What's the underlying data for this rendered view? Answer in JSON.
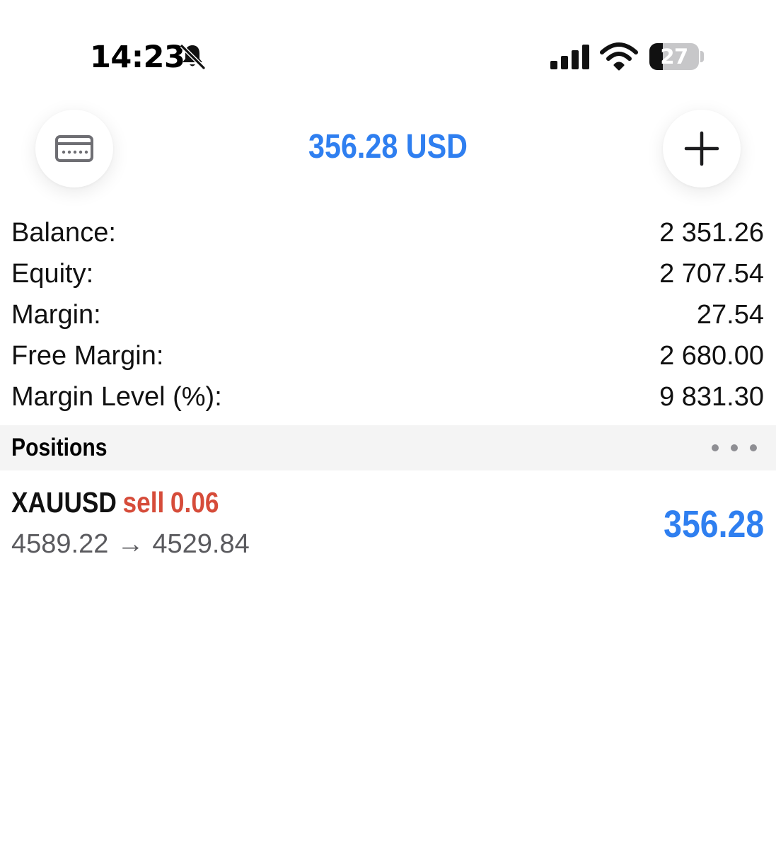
{
  "status_bar": {
    "time": "14:23",
    "battery_level": "27",
    "icons": [
      "bell-slash-icon",
      "signal-icon",
      "wifi-icon",
      "battery-icon"
    ]
  },
  "header": {
    "total": "356.28 USD",
    "left_icon": "card-icon",
    "right_icon": "plus-icon",
    "accent_color": "#2f7ff0"
  },
  "summary": {
    "rows": [
      {
        "label": "Balance:",
        "value": "2 351.26"
      },
      {
        "label": "Equity:",
        "value": "2 707.54"
      },
      {
        "label": "Margin:",
        "value": "27.54"
      },
      {
        "label": "Free Margin:",
        "value": "2 680.00"
      },
      {
        "label": "Margin Level (%):",
        "value": "9 831.30"
      }
    ]
  },
  "positions": {
    "title": "Positions",
    "menu_icon": "more-dots-icon",
    "items": [
      {
        "symbol": "XAUUSD",
        "side": "sell",
        "volume": "0.06",
        "open_price": "4589.22",
        "arrow": "→",
        "current_price": "4529.84",
        "profit": "356.28",
        "side_color": "#d64c3a",
        "profit_color": "#2f7ff0"
      }
    ]
  }
}
